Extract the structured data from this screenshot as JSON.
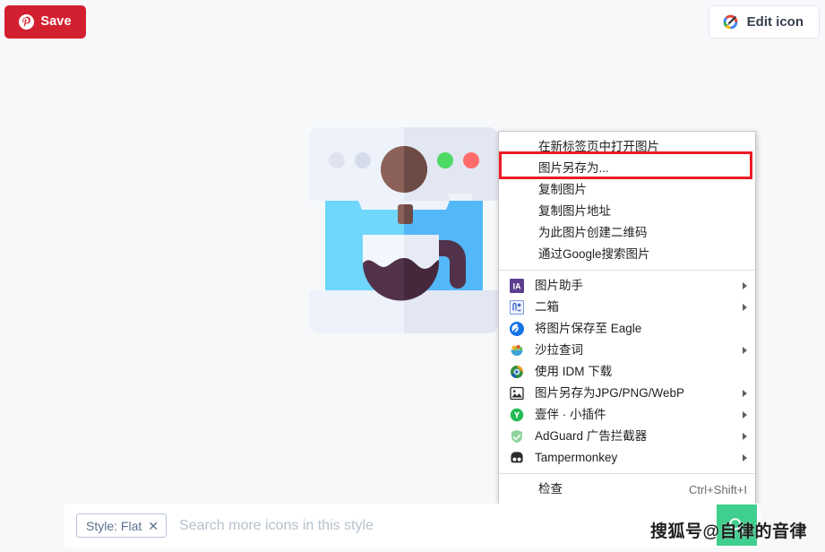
{
  "topbar": {
    "save_label": "Save",
    "save_icon": "pinterest-logo-icon",
    "save_color": "#d32030",
    "edit_label": "Edit icon",
    "edit_icon": "colored-pencil-icon"
  },
  "preview": {
    "icon_name": "coffee-machine-flat-icon",
    "colors": {
      "body_light": "#eef3fb",
      "body_shade": "#e4e8f2",
      "panel_cyan": "#6fd7fb",
      "panel_cyan_dark": "#54b9f7",
      "coffee_brown": "#8c6159",
      "coffee_dark": "#4e2e3c",
      "dot_green": "#4cd964",
      "dot_red": "#ff6b6b",
      "dot_grey": "#dfe3ee"
    }
  },
  "context_menu": {
    "sections": [
      {
        "items": [
          {
            "label": "在新标签页中打开图片",
            "icon": null,
            "submenu": false,
            "shortcut": "",
            "highlighted": false
          },
          {
            "label": "图片另存为...",
            "icon": null,
            "submenu": false,
            "shortcut": "",
            "highlighted": true
          },
          {
            "label": "复制图片",
            "icon": null,
            "submenu": false,
            "shortcut": "",
            "highlighted": false
          },
          {
            "label": "复制图片地址",
            "icon": null,
            "submenu": false,
            "shortcut": "",
            "highlighted": false
          },
          {
            "label": "为此图片创建二维码",
            "icon": null,
            "submenu": false,
            "shortcut": "",
            "highlighted": false
          },
          {
            "label": "通过Google搜索图片",
            "icon": null,
            "submenu": false,
            "shortcut": "",
            "highlighted": false
          }
        ]
      },
      {
        "items": [
          {
            "label": "图片助手",
            "icon": "image-assistant-icon",
            "submenu": true,
            "shortcut": "",
            "highlighted": false
          },
          {
            "label": "二箱",
            "icon": "erxiang-icon",
            "submenu": true,
            "shortcut": "",
            "highlighted": false
          },
          {
            "label": "将图片保存至 Eagle",
            "icon": "eagle-icon",
            "submenu": false,
            "shortcut": "",
            "highlighted": false
          },
          {
            "label": "沙拉查词",
            "icon": "saladict-icon",
            "submenu": true,
            "shortcut": "",
            "highlighted": false
          },
          {
            "label": "使用 IDM 下载",
            "icon": "idm-icon",
            "submenu": false,
            "shortcut": "",
            "highlighted": false
          },
          {
            "label": "图片另存为JPG/PNG/WebP",
            "icon": "image-format-icon",
            "submenu": true,
            "shortcut": "",
            "highlighted": false
          },
          {
            "label": "壹伴 · 小插件",
            "icon": "yiban-icon",
            "submenu": true,
            "shortcut": "",
            "highlighted": false
          },
          {
            "label": "AdGuard 广告拦截器",
            "icon": "adguard-shield-icon",
            "submenu": true,
            "shortcut": "",
            "highlighted": false
          },
          {
            "label": "Tampermonkey",
            "icon": "tampermonkey-icon",
            "submenu": true,
            "shortcut": "",
            "highlighted": false
          }
        ]
      },
      {
        "items": [
          {
            "label": "检查",
            "icon": null,
            "submenu": false,
            "shortcut": "Ctrl+Shift+I",
            "highlighted": false
          }
        ]
      }
    ],
    "highlight_color": "#ee1c24"
  },
  "search": {
    "chip_label": "Style: Flat",
    "chip_close": "✕",
    "placeholder": "Search more icons in this style",
    "value": "",
    "submit_icon": "search-icon",
    "submit_color": "#3fcf8e"
  },
  "watermark": {
    "text": "搜狐号@自律的音律"
  }
}
